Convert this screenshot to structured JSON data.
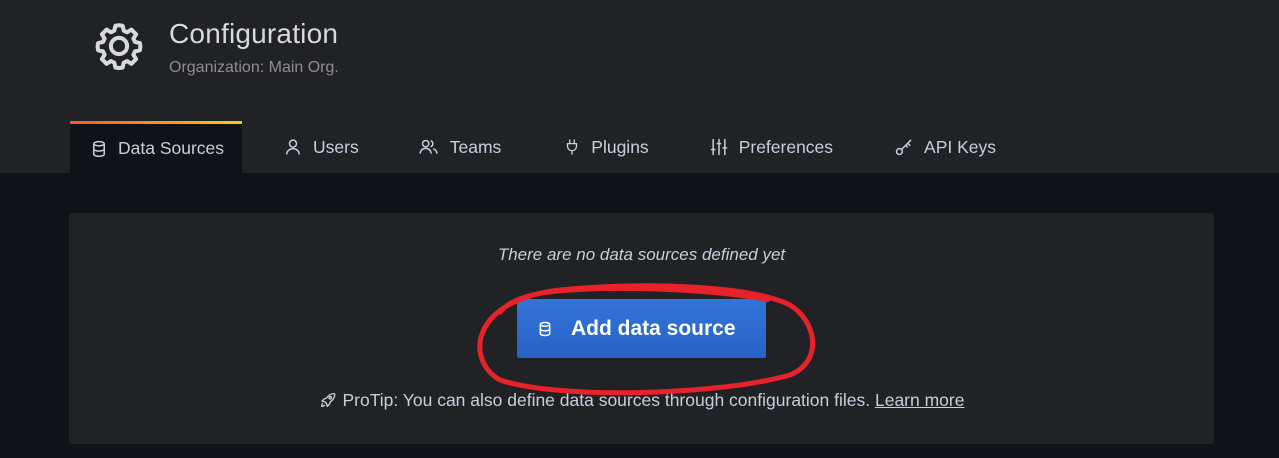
{
  "header": {
    "icon": "gear-icon",
    "title": "Configuration",
    "subtitle": "Organization: Main Org."
  },
  "tabs": [
    {
      "label": "Data Sources",
      "icon": "database-icon",
      "active": true
    },
    {
      "label": "Users",
      "icon": "user-icon",
      "active": false
    },
    {
      "label": "Teams",
      "icon": "users-icon",
      "active": false
    },
    {
      "label": "Plugins",
      "icon": "plug-icon",
      "active": false
    },
    {
      "label": "Preferences",
      "icon": "sliders-icon",
      "active": false
    },
    {
      "label": "API Keys",
      "icon": "key-icon",
      "active": false
    }
  ],
  "empty_state": {
    "message": "There are no data sources defined yet",
    "button_label": "Add data source",
    "button_icon": "database-icon",
    "protip_icon": "rocket-icon",
    "protip_text": "ProTip: You can also define data sources through configuration files.",
    "protip_link": "Learn more"
  },
  "colors": {
    "background": "#111217",
    "panel": "#202226",
    "primary_button": "#3274d9",
    "active_tab_accent_start": "#f05a28",
    "active_tab_accent_end": "#fbca0a",
    "annotation": "#e8222a"
  }
}
